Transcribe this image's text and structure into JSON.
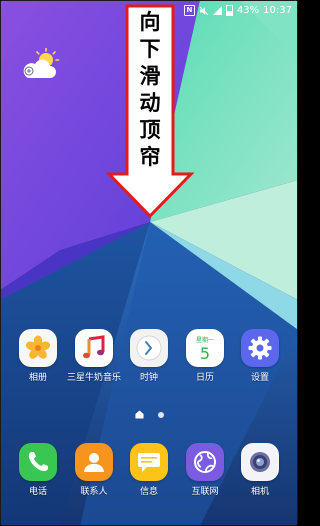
{
  "status_bar": {
    "nfc_label": "N",
    "battery_percent": "43%",
    "time": "10:37",
    "icons": [
      "nfc-icon",
      "mute-icon",
      "signal-icon",
      "battery-icon"
    ]
  },
  "annotation": {
    "text_chars": [
      "向",
      "下",
      "滑",
      "动",
      "顶",
      "帘"
    ]
  },
  "apps": [
    {
      "name": "gallery",
      "label": "相册",
      "icon": "flower-icon",
      "color": "#f7f7f7"
    },
    {
      "name": "samsung-music",
      "label": "三星牛奶音乐",
      "icon": "music-note-icon",
      "color": "#ffffff"
    },
    {
      "name": "clock",
      "label": "时钟",
      "icon": "clock-icon",
      "color": "#f2f2f2"
    },
    {
      "name": "calendar",
      "label": "日历",
      "icon": "calendar-icon",
      "color": "#ffffff",
      "calendar_day": "5",
      "calendar_weekday": "星期一"
    },
    {
      "name": "settings",
      "label": "设置",
      "icon": "gear-icon",
      "color": "#5b67ec"
    }
  ],
  "dock": [
    {
      "name": "phone",
      "label": "电话",
      "icon": "phone-icon",
      "color": "#39c652"
    },
    {
      "name": "contacts",
      "label": "联系人",
      "icon": "contact-icon",
      "color": "#f7941d"
    },
    {
      "name": "messages",
      "label": "信息",
      "icon": "message-icon",
      "color": "#fcc419"
    },
    {
      "name": "internet",
      "label": "互联网",
      "icon": "globe-icon",
      "color": "#7b5ce0"
    },
    {
      "name": "camera",
      "label": "相机",
      "icon": "camera-icon",
      "color": "#f4f4f8"
    }
  ]
}
